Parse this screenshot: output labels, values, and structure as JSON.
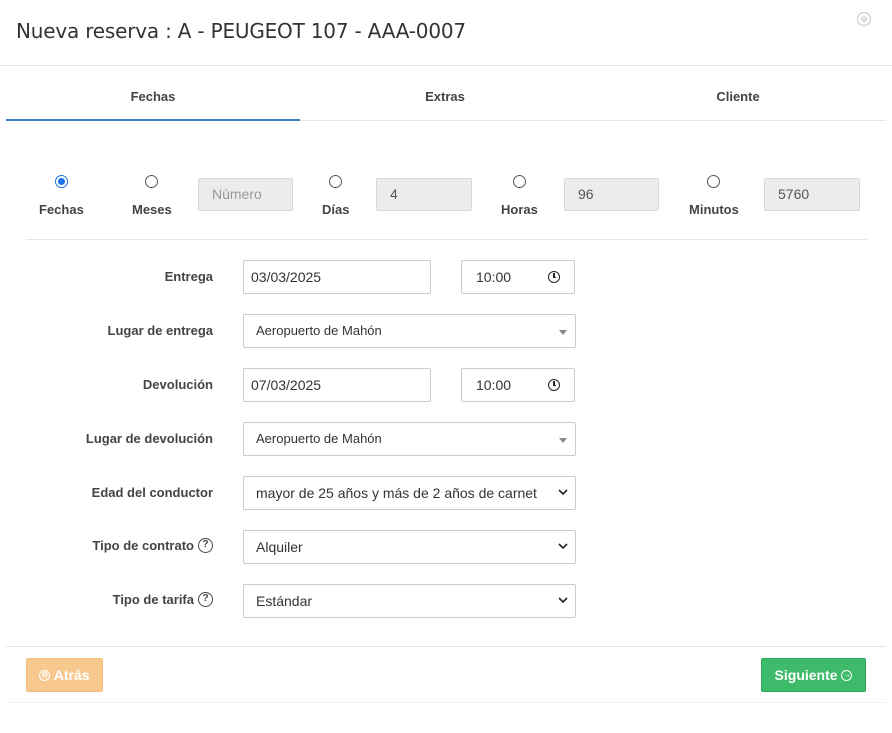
{
  "modal": {
    "title": "Nueva reserva : A - PEUGEOT 107 - AAA-0007",
    "close_icon": "⊗"
  },
  "tabs": [
    {
      "label": "Fechas",
      "active": true
    },
    {
      "label": "Extras",
      "active": false
    },
    {
      "label": "Cliente",
      "active": false
    }
  ],
  "duration": {
    "fechas_label": "Fechas",
    "meses_label": "Meses",
    "meses_placeholder": "Número",
    "dias_label": "Días",
    "dias_value": "4",
    "horas_label": "Horas",
    "horas_value": "96",
    "minutos_label": "Minutos",
    "minutos_value": "5760",
    "selected": "Fechas"
  },
  "form": {
    "entrega_label": "Entrega",
    "entrega_date": "03/03/2025",
    "entrega_time": "10:00",
    "lugar_entrega_label": "Lugar de entrega",
    "lugar_entrega_value": "Aeropuerto de Mahón",
    "devolucion_label": "Devolución",
    "devolucion_date": "07/03/2025",
    "devolucion_time": "10:00",
    "lugar_devolucion_label": "Lugar de devolución",
    "lugar_devolucion_value": "Aeropuerto de Mahón",
    "edad_label": "Edad del conductor",
    "edad_value": "mayor de 25 años y más de 2 años de carnet",
    "contrato_label": "Tipo de contrato",
    "contrato_value": "Alquiler",
    "tarifa_label": "Tipo de tarifa",
    "tarifa_value": "Estándar",
    "help_icon": "?"
  },
  "footer": {
    "back_label": "Atrás",
    "next_label": "Siguiente",
    "back_icon": "⊖",
    "next_icon": "→"
  },
  "colors": {
    "accent": "#3c7fc4",
    "radio_checked": "#1a73e8",
    "back_button": "#f8c98f",
    "next_button": "#3dbb6a"
  }
}
